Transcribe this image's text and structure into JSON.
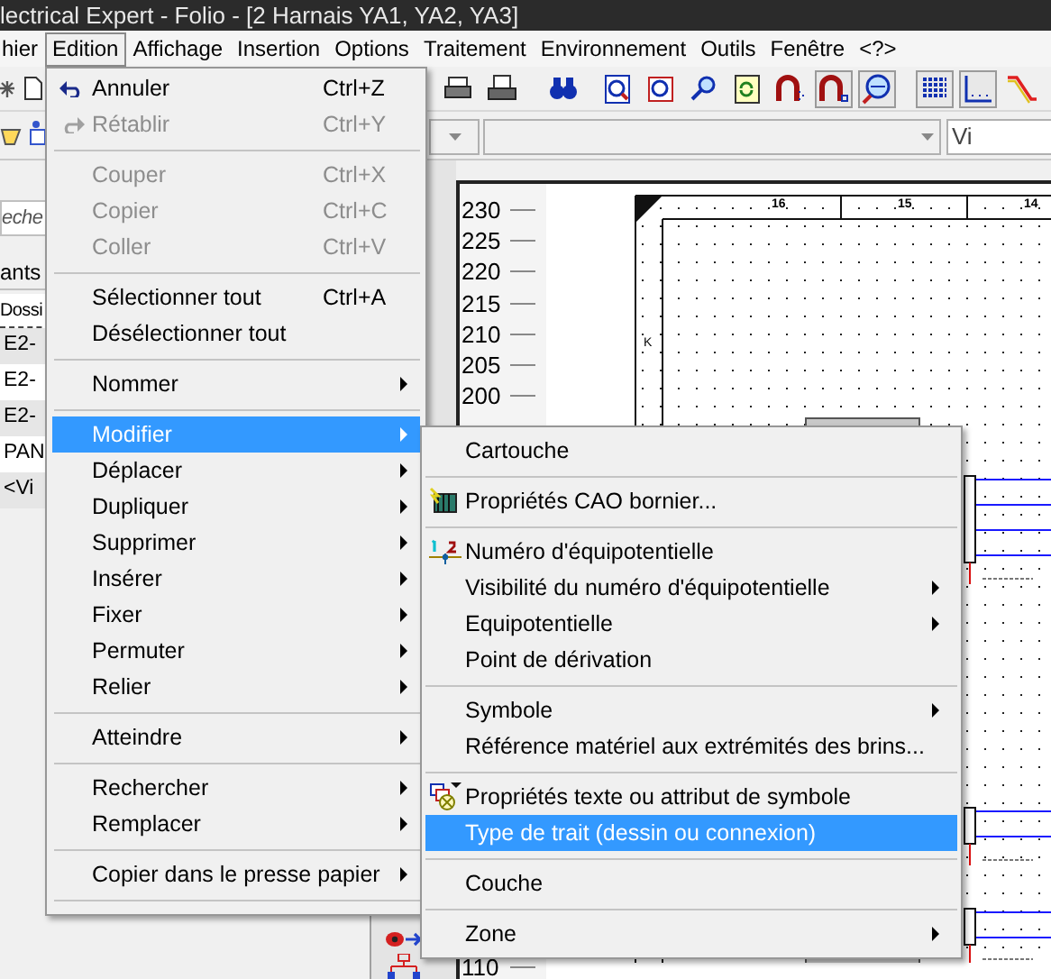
{
  "window": {
    "title": "lectrical Expert - Folio - [2 Harnais YA1, YA2, YA3]"
  },
  "menu_bar": [
    {
      "label": "hier",
      "selected": false
    },
    {
      "label": "Edition",
      "selected": true
    },
    {
      "label": "Affichage",
      "selected": false
    },
    {
      "label": "Insertion",
      "selected": false
    },
    {
      "label": "Options",
      "selected": false
    },
    {
      "label": "Traitement",
      "selected": false
    },
    {
      "label": "Environnement",
      "selected": false
    },
    {
      "label": "Outils",
      "selected": false
    },
    {
      "label": "Fenêtre",
      "selected": false
    },
    {
      "label": "<?>",
      "selected": false
    }
  ],
  "toolbar_buttons": [
    {
      "pressed": false
    },
    {
      "pressed": false
    },
    {
      "pressed": false
    },
    {
      "pressed": false
    },
    {
      "pressed": false
    },
    {
      "pressed": false
    },
    {
      "pressed": false
    },
    {
      "pressed": false
    },
    {
      "pressed": true
    },
    {
      "pressed": true
    },
    {
      "pressed": true
    },
    {
      "pressed": true
    },
    {
      "pressed": false
    }
  ],
  "view_dropdown": {
    "value": "Vi"
  },
  "left_panel": {
    "search_placeholder": "eche",
    "tab": "ants",
    "column_header": "Dossi",
    "rows": [
      "E2-",
      "E2-",
      "E2-",
      "PAN",
      "<Vi"
    ]
  },
  "ruler": {
    "top_labels": [
      "230",
      "225",
      "220",
      "215",
      "210",
      "205",
      "200"
    ],
    "bottom_labels": [
      "110"
    ]
  },
  "drawing": {
    "column_labels": [
      "16",
      "15",
      "14"
    ],
    "row_labels": [
      "K"
    ]
  },
  "edition_menu": {
    "items": [
      {
        "kind": "item",
        "label": "Annuler",
        "shortcut": "Ctrl+Z",
        "disabled": false,
        "submenu": false,
        "selected": false
      },
      {
        "kind": "item",
        "label": "Rétablir",
        "shortcut": "Ctrl+Y",
        "disabled": true,
        "submenu": false,
        "selected": false
      },
      {
        "kind": "separator"
      },
      {
        "kind": "item",
        "label": "Couper",
        "shortcut": "Ctrl+X",
        "disabled": true,
        "submenu": false,
        "selected": false
      },
      {
        "kind": "item",
        "label": "Copier",
        "shortcut": "Ctrl+C",
        "disabled": true,
        "submenu": false,
        "selected": false
      },
      {
        "kind": "item",
        "label": "Coller",
        "shortcut": "Ctrl+V",
        "disabled": true,
        "submenu": false,
        "selected": false
      },
      {
        "kind": "separator"
      },
      {
        "kind": "item",
        "label": "Sélectionner tout",
        "shortcut": "Ctrl+A",
        "disabled": false,
        "submenu": false,
        "selected": false
      },
      {
        "kind": "item",
        "label": "Désélectionner tout",
        "disabled": false,
        "submenu": false,
        "selected": false
      },
      {
        "kind": "separator"
      },
      {
        "kind": "item",
        "label": "Nommer",
        "disabled": false,
        "submenu": true,
        "selected": false
      },
      {
        "kind": "separator"
      },
      {
        "kind": "item",
        "label": "Modifier",
        "disabled": false,
        "submenu": true,
        "selected": true
      },
      {
        "kind": "item",
        "label": "Déplacer",
        "disabled": false,
        "submenu": true,
        "selected": false
      },
      {
        "kind": "item",
        "label": "Dupliquer",
        "disabled": false,
        "submenu": true,
        "selected": false
      },
      {
        "kind": "item",
        "label": "Supprimer",
        "disabled": false,
        "submenu": true,
        "selected": false
      },
      {
        "kind": "item",
        "label": "Insérer",
        "disabled": false,
        "submenu": true,
        "selected": false
      },
      {
        "kind": "item",
        "label": "Fixer",
        "disabled": false,
        "submenu": true,
        "selected": false
      },
      {
        "kind": "item",
        "label": "Permuter",
        "disabled": false,
        "submenu": true,
        "selected": false
      },
      {
        "kind": "item",
        "label": "Relier",
        "disabled": false,
        "submenu": true,
        "selected": false
      },
      {
        "kind": "separator"
      },
      {
        "kind": "item",
        "label": "Atteindre",
        "disabled": false,
        "submenu": true,
        "selected": false
      },
      {
        "kind": "separator"
      },
      {
        "kind": "item",
        "label": "Rechercher",
        "disabled": false,
        "submenu": true,
        "selected": false
      },
      {
        "kind": "item",
        "label": "Remplacer",
        "disabled": false,
        "submenu": true,
        "selected": false
      },
      {
        "kind": "separator"
      },
      {
        "kind": "item",
        "label": "Copier dans le presse papier",
        "disabled": false,
        "submenu": true,
        "selected": false
      },
      {
        "kind": "separator"
      }
    ]
  },
  "modifier_submenu": {
    "items": [
      {
        "kind": "item",
        "label": "Cartouche",
        "disabled": false,
        "submenu": false,
        "selected": false
      },
      {
        "kind": "separator"
      },
      {
        "kind": "item",
        "label": "Propriétés CAO bornier...",
        "disabled": false,
        "submenu": false,
        "selected": false
      },
      {
        "kind": "separator"
      },
      {
        "kind": "item",
        "label": "Numéro d'équipotentielle",
        "disabled": false,
        "submenu": false,
        "selected": false
      },
      {
        "kind": "item",
        "label": "Visibilité du numéro d'équipotentielle",
        "disabled": false,
        "submenu": true,
        "selected": false
      },
      {
        "kind": "item",
        "label": "Equipotentielle",
        "disabled": false,
        "submenu": true,
        "selected": false
      },
      {
        "kind": "item",
        "label": "Point de dérivation",
        "disabled": false,
        "submenu": false,
        "selected": false
      },
      {
        "kind": "separator"
      },
      {
        "kind": "item",
        "label": "Symbole",
        "disabled": false,
        "submenu": true,
        "selected": false
      },
      {
        "kind": "item",
        "label": "Référence matériel aux extrémités des brins...",
        "disabled": false,
        "submenu": false,
        "selected": false
      },
      {
        "kind": "separator"
      },
      {
        "kind": "item",
        "label": "Propriétés texte ou attribut de symbole",
        "disabled": false,
        "submenu": false,
        "selected": false
      },
      {
        "kind": "item",
        "label": "Type de trait (dessin ou connexion)",
        "disabled": false,
        "submenu": false,
        "selected": true
      },
      {
        "kind": "separator"
      },
      {
        "kind": "item",
        "label": "Couche",
        "disabled": false,
        "submenu": false,
        "selected": false
      },
      {
        "kind": "separator"
      },
      {
        "kind": "item",
        "label": "Zone",
        "disabled": false,
        "submenu": true,
        "selected": false
      }
    ]
  }
}
